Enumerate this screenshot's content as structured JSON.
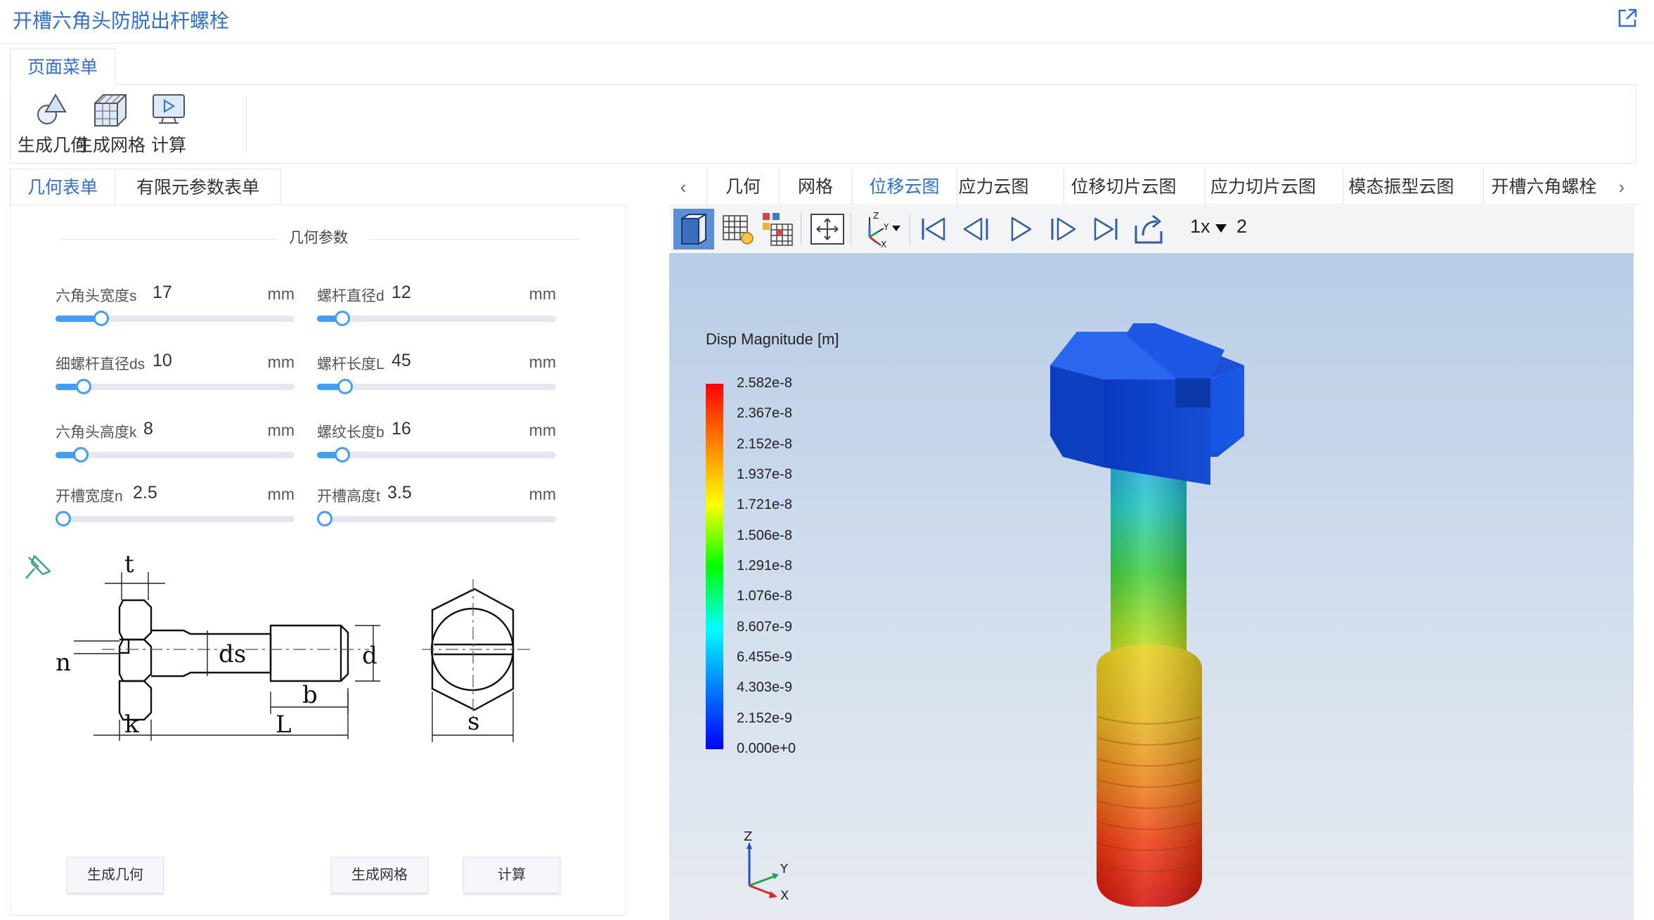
{
  "window": {
    "title": "开槽六角头防脱出杆螺栓",
    "export_icon": "external-link-icon"
  },
  "page_menu": {
    "tab_label": "页面菜单",
    "buttons": [
      {
        "label": "生成几何",
        "icon": "geometry-icon"
      },
      {
        "label": "生成网格",
        "icon": "mesh-icon"
      },
      {
        "label": "计算",
        "icon": "compute-icon"
      }
    ]
  },
  "left_panel": {
    "tabs": [
      {
        "label": "几何表单",
        "active": true
      },
      {
        "label": "有限元参数表单",
        "active": false
      }
    ],
    "section_title": "几何参数",
    "params": [
      {
        "name": "六角头宽度s",
        "value": "17",
        "unit": "mm",
        "fraction": 0.17
      },
      {
        "name": "螺杆直径d",
        "value": "12",
        "unit": "mm",
        "fraction": 0.08
      },
      {
        "name": "细螺杆直径ds",
        "value": "10",
        "unit": "mm",
        "fraction": 0.09
      },
      {
        "name": "螺杆长度L",
        "value": "45",
        "unit": "mm",
        "fraction": 0.09
      },
      {
        "name": "六角头高度k",
        "value": "8",
        "unit": "mm",
        "fraction": 0.08
      },
      {
        "name": "螺纹长度b",
        "value": "16",
        "unit": "mm",
        "fraction": 0.08
      },
      {
        "name": "开槽宽度n",
        "value": "2.5",
        "unit": "mm",
        "fraction": 0.0
      },
      {
        "name": "开槽高度t",
        "value": "3.5",
        "unit": "mm",
        "fraction": 0.0
      }
    ],
    "drawing_labels": {
      "t": "t",
      "n": "n",
      "ds": "ds",
      "d": "d",
      "b": "b",
      "k": "k",
      "L": "L",
      "s": "s"
    },
    "buttons": {
      "geometry": "生成几何",
      "mesh": "生成网格",
      "compute": "计算"
    }
  },
  "result_tabs": {
    "prev_arrow": "‹",
    "next_arrow": "›",
    "items": [
      {
        "label": "几何",
        "active": false
      },
      {
        "label": "网格",
        "active": false
      },
      {
        "label": "位移云图",
        "active": true
      },
      {
        "label": "应力云图",
        "active": false
      },
      {
        "label": "位移切片云图",
        "active": false
      },
      {
        "label": "应力切片云图",
        "active": false
      },
      {
        "label": "模态振型云图",
        "active": false
      },
      {
        "label": "开槽六角螺栓",
        "active": false
      }
    ]
  },
  "toolbar": {
    "icons": [
      "view-cube-icon",
      "mesh-toggle-icon",
      "color-map-icon",
      "fit-view-icon",
      "axes-orientation-icon",
      "first-frame-icon",
      "prev-frame-icon",
      "play-icon",
      "next-frame-icon",
      "last-frame-icon",
      "export-icon"
    ],
    "speed": "1x",
    "frame": "2"
  },
  "viewport": {
    "legend_title": "Disp Magnitude [m]",
    "legend_values": [
      "2.582e-8",
      "2.367e-8",
      "2.152e-8",
      "1.937e-8",
      "1.721e-8",
      "1.506e-8",
      "1.291e-8",
      "1.076e-8",
      "8.607e-9",
      "6.455e-9",
      "4.303e-9",
      "2.152e-9",
      "0.000e+0"
    ],
    "axes": {
      "z": "Z",
      "y": "Y",
      "x": "X"
    }
  }
}
